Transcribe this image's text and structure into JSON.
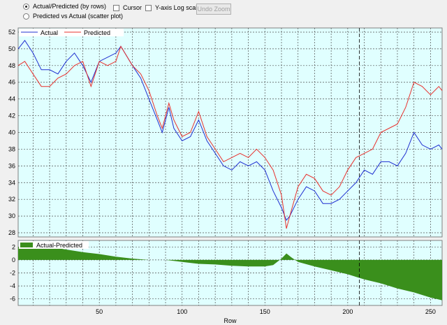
{
  "toolbar": {
    "radio_rows_label": "Actual/Predicted (by rows)",
    "radio_scatter_label": "Predicted vs Actual (scatter plot)",
    "cursor_label": "Cursor",
    "ylog_label": "Y-axis Log scale",
    "undo_zoom_label": "Undo Zoom"
  },
  "colors": {
    "plot_bg": "#e0ffff",
    "actual": "#1f2fd0",
    "predicted": "#e8302c",
    "diff_fill": "#3a8f1c"
  },
  "chart_data": [
    {
      "type": "line",
      "legend_position": "top-left",
      "grid": true,
      "xlim": [
        1,
        257
      ],
      "ylim": [
        27.5,
        52.5
      ],
      "y_ticks": [
        28,
        30,
        32,
        34,
        36,
        38,
        40,
        42,
        44,
        46,
        48,
        50,
        52
      ],
      "cursor_x": 207,
      "x": [
        1,
        5,
        10,
        15,
        20,
        25,
        30,
        35,
        40,
        45,
        50,
        55,
        60,
        63,
        70,
        75,
        80,
        85,
        88,
        92,
        95,
        100,
        105,
        110,
        115,
        120,
        125,
        130,
        135,
        140,
        145,
        150,
        155,
        160,
        163,
        165,
        170,
        175,
        180,
        185,
        190,
        195,
        200,
        205,
        210,
        215,
        220,
        225,
        230,
        235,
        240,
        245,
        250,
        255,
        257
      ],
      "series": [
        {
          "name": "Actual",
          "values": [
            50.0,
            51.0,
            49.5,
            47.5,
            47.5,
            47.0,
            48.5,
            49.5,
            48.0,
            46.0,
            48.5,
            49.0,
            49.5,
            50.3,
            48.0,
            46.5,
            44.0,
            41.5,
            40.0,
            43.0,
            40.5,
            39.0,
            39.5,
            41.5,
            39.0,
            37.5,
            36.0,
            35.5,
            36.5,
            36.0,
            36.5,
            35.5,
            33.0,
            31.0,
            29.5,
            30.0,
            32.0,
            33.5,
            33.0,
            31.5,
            31.5,
            32.0,
            33.0,
            34.0,
            35.5,
            35.0,
            36.5,
            36.5,
            36.0,
            37.5,
            40.0,
            38.5,
            38.0,
            38.5,
            38.0
          ]
        },
        {
          "name": "Predicted",
          "values": [
            48.0,
            48.5,
            47.0,
            45.5,
            45.5,
            46.5,
            47.0,
            48.0,
            48.5,
            45.5,
            48.5,
            48.0,
            48.5,
            50.3,
            48.0,
            47.0,
            45.0,
            42.0,
            40.5,
            43.5,
            41.5,
            39.5,
            40.0,
            42.5,
            39.5,
            38.0,
            36.5,
            37.0,
            37.5,
            37.0,
            38.0,
            37.0,
            35.5,
            32.5,
            28.5,
            30.0,
            33.5,
            35.0,
            34.5,
            33.0,
            32.5,
            33.5,
            35.5,
            37.0,
            37.5,
            38.0,
            40.0,
            40.5,
            41.0,
            43.0,
            46.0,
            45.5,
            44.5,
            45.5,
            45.0
          ]
        }
      ]
    },
    {
      "type": "area",
      "legend_position": "top-left",
      "grid": true,
      "xlim": [
        1,
        257
      ],
      "ylim": [
        -7,
        3
      ],
      "y_ticks": [
        -6,
        -4,
        -2,
        0,
        2
      ],
      "x_ticks": [
        50,
        100,
        150,
        200,
        250
      ],
      "xlabel": "Row",
      "cursor_x": 207,
      "x": [
        1,
        10,
        20,
        30,
        40,
        50,
        60,
        70,
        80,
        90,
        100,
        110,
        120,
        130,
        140,
        150,
        155,
        160,
        163,
        166,
        170,
        180,
        190,
        200,
        205,
        210,
        220,
        230,
        240,
        250,
        257
      ],
      "series": [
        {
          "name": "Actual-Predicted",
          "values": [
            2.0,
            2.2,
            2.0,
            1.6,
            1.2,
            0.9,
            0.5,
            0.2,
            0.0,
            0.0,
            -0.3,
            -0.6,
            -0.7,
            -0.9,
            -1.0,
            -1.0,
            -0.8,
            0.2,
            1.0,
            0.4,
            -0.3,
            -1.0,
            -1.6,
            -2.2,
            -2.6,
            -3.0,
            -3.6,
            -4.4,
            -5.0,
            -5.8,
            -6.2
          ]
        }
      ]
    }
  ]
}
